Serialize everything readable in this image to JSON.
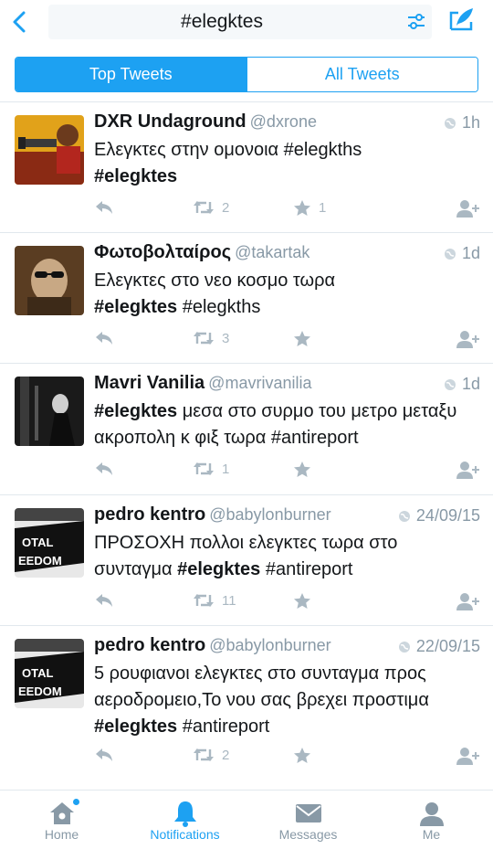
{
  "search": {
    "query": "#elegktes"
  },
  "tabs": [
    {
      "label": "Top Tweets"
    },
    {
      "label": "All Tweets"
    }
  ],
  "tweets": [
    {
      "name": "DXR Undaground",
      "handle": "@dxrone",
      "time": "1h",
      "text_parts": [
        "Ελεγκτες στην ομονοια #elegkths",
        "#elegktes",
        ""
      ],
      "retweets": "2",
      "likes": "1"
    },
    {
      "name": "Φωτοβολταίρος",
      "handle": "@takartak",
      "time": "1d",
      "text_parts": [
        "Ελεγκτες στο νεο κοσμο τωρα",
        "#elegktes",
        " #elegkths"
      ],
      "retweets": "3",
      "likes": ""
    },
    {
      "name": "Mavri Vanilia",
      "handle": "@mavrivanilia",
      "time": "1d",
      "text_parts": [
        "",
        "#elegktes",
        " μεσα στο συρμο του μετρο μεταξυ ακροπολη κ φιξ τωρα #antireport"
      ],
      "retweets": "1",
      "likes": ""
    },
    {
      "name": "pedro kentro",
      "handle": "@babylonburner",
      "time": "24/09/15",
      "text_parts": [
        "ΠΡΟΣΟΧΗ πολλοι ελεγκτες τωρα στο συνταγμα ",
        "#elegktes",
        " #antireport"
      ],
      "retweets": "11",
      "likes": ""
    },
    {
      "name": "pedro kentro",
      "handle": "@babylonburner",
      "time": "22/09/15",
      "text_parts": [
        "5 ρουφιανοι ελεγκτες στο συνταγμα προς αεροδρομειο,Το νου σας βρεχει προστιμα ",
        "#elegktes",
        " #antireport"
      ],
      "retweets": "2",
      "likes": ""
    }
  ],
  "tabbar": [
    {
      "label": "Home",
      "icon": "home-icon"
    },
    {
      "label": "Notifications",
      "icon": "bell-icon"
    },
    {
      "label": "Messages",
      "icon": "envelope-icon"
    },
    {
      "label": "Me",
      "icon": "person-icon"
    }
  ],
  "colors": {
    "accent": "#1da1f2",
    "muted": "#8899a6",
    "icon": "#aab8c2"
  }
}
